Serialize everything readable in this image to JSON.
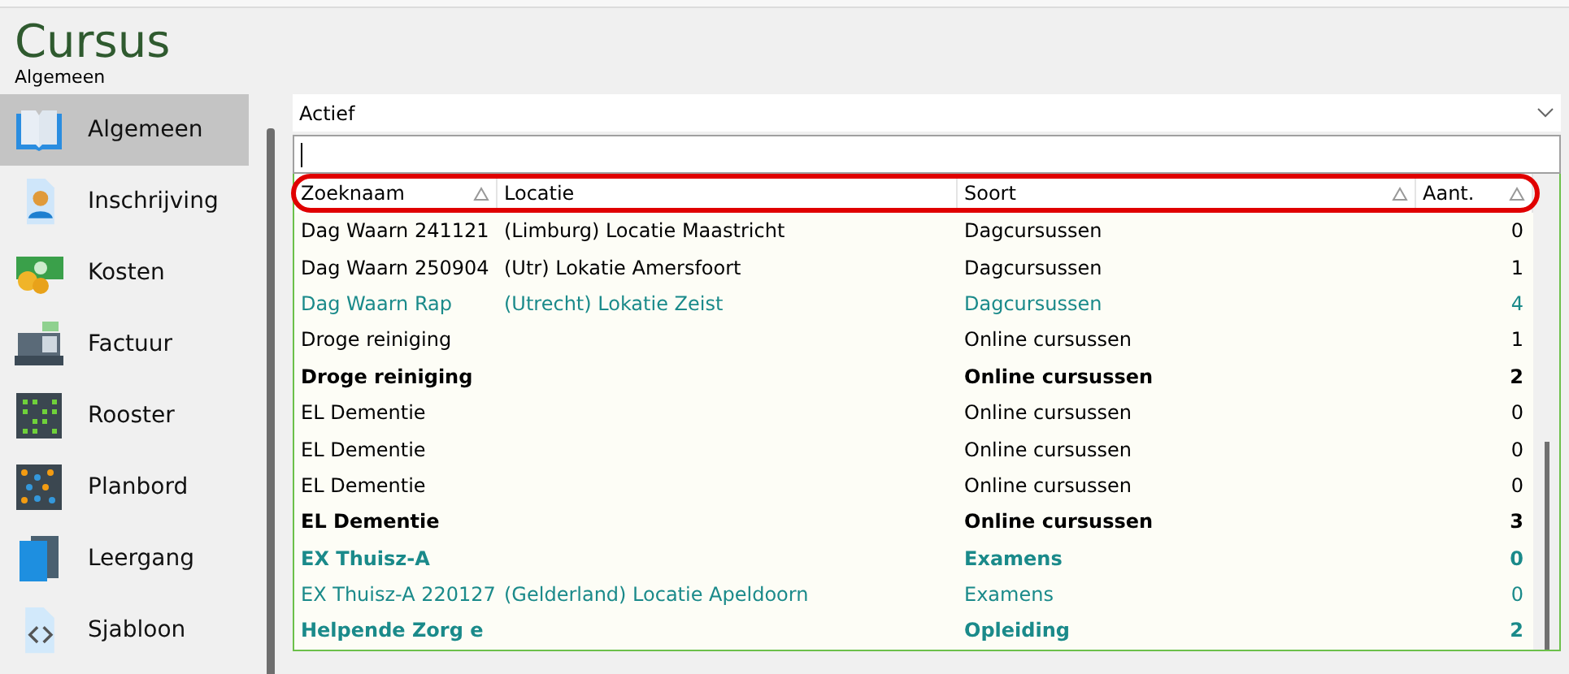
{
  "header": {
    "title": "Cursus",
    "subtitle": "Algemeen"
  },
  "sidebar": {
    "items": [
      {
        "label": "Algemeen",
        "selected": true
      },
      {
        "label": "Inschrijving",
        "selected": false
      },
      {
        "label": "Kosten",
        "selected": false
      },
      {
        "label": "Factuur",
        "selected": false
      },
      {
        "label": "Rooster",
        "selected": false
      },
      {
        "label": "Planbord",
        "selected": false
      },
      {
        "label": "Leergang",
        "selected": false
      },
      {
        "label": "Sjabloon",
        "selected": false
      }
    ]
  },
  "filter": {
    "value": "Actief"
  },
  "table": {
    "columns": [
      {
        "label": "Zoeknaam",
        "sortable": true
      },
      {
        "label": "Locatie",
        "sortable": false
      },
      {
        "label": "Soort",
        "sortable": true
      },
      {
        "label": "Aant.",
        "sortable": true
      }
    ],
    "rows": [
      {
        "cells": [
          "Dag Waarn 241121",
          "(Limburg) Locatie Maastricht",
          "Dagcursussen",
          "0"
        ],
        "bold": false,
        "color": "#000000"
      },
      {
        "cells": [
          "Dag Waarn 250904",
          "(Utr) Lokatie Amersfoort",
          "Dagcursussen",
          "1"
        ],
        "bold": false,
        "color": "#000000"
      },
      {
        "cells": [
          "Dag Waarn Rap",
          "(Utrecht) Lokatie Zeist",
          "Dagcursussen",
          "4"
        ],
        "bold": false,
        "color": "#1a8a8a"
      },
      {
        "cells": [
          "Droge reiniging",
          "",
          "Online cursussen",
          "1"
        ],
        "bold": false,
        "color": "#000000"
      },
      {
        "cells": [
          "Droge reiniging",
          "",
          "Online cursussen",
          "2"
        ],
        "bold": true,
        "color": "#000000"
      },
      {
        "cells": [
          "EL Dementie",
          "",
          "Online cursussen",
          "0"
        ],
        "bold": false,
        "color": "#000000"
      },
      {
        "cells": [
          "EL Dementie",
          "",
          "Online cursussen",
          "0"
        ],
        "bold": false,
        "color": "#000000"
      },
      {
        "cells": [
          "EL Dementie",
          "",
          "Online cursussen",
          "0"
        ],
        "bold": false,
        "color": "#000000"
      },
      {
        "cells": [
          "EL Dementie",
          "",
          "Online cursussen",
          "3"
        ],
        "bold": true,
        "color": "#000000"
      },
      {
        "cells": [
          "EX Thuisz-A",
          "",
          "Examens",
          "0"
        ],
        "bold": true,
        "color": "#1a8a8a"
      },
      {
        "cells": [
          "EX Thuisz-A 220127",
          "(Gelderland) Locatie Apeldoorn",
          "Examens",
          "0"
        ],
        "bold": false,
        "color": "#1a8a8a"
      },
      {
        "cells": [
          "Helpende Zorg e",
          "",
          "Opleiding",
          "2"
        ],
        "bold": true,
        "color": "#1a8a8a"
      }
    ]
  }
}
